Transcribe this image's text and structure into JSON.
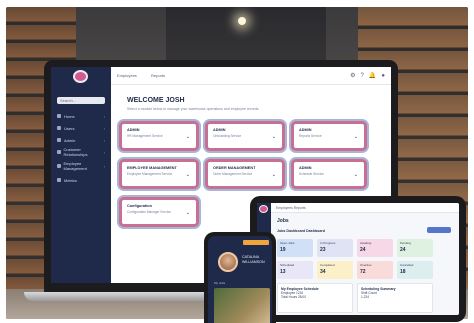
{
  "app": {
    "topbar_menu": [
      "Employees",
      "Reports"
    ],
    "welcome_title": "WELCOME JOSH",
    "welcome_sub": "Select a module below to manage your warehouse operations and employee records."
  },
  "sidebar": {
    "search_placeholder": "Search...",
    "items": [
      {
        "label": "Home"
      },
      {
        "label": "Users"
      },
      {
        "label": "Admin"
      },
      {
        "label": "Customer Relationships"
      },
      {
        "label": "Employee Management"
      },
      {
        "label": "Metrics"
      }
    ]
  },
  "modules": [
    {
      "title": "ADMIN",
      "sub": "HR Management Service"
    },
    {
      "title": "ADMIN",
      "sub": "Onboarding Service"
    },
    {
      "title": "ADMIN",
      "sub": "Reports Service"
    },
    {
      "title": "EMPLOYEE MANAGEMENT",
      "sub": "Employee Management Service"
    },
    {
      "title": "ORDER MANAGEMENT",
      "sub": "Order Management Service"
    },
    {
      "title": "ADMIN",
      "sub": "Schedule Service"
    },
    {
      "title": "Configuration",
      "sub": "Configuration Manager Service"
    }
  ],
  "tablet": {
    "title": "Jobs",
    "section": "Jobs Dashboard Dashboard",
    "top_menu": "Employees   Reports",
    "cards": [
      {
        "label": "Open Jobs",
        "value": "19",
        "color": "#cfe0f7"
      },
      {
        "label": "In Progress",
        "value": "23",
        "color": "#dfe3f3"
      },
      {
        "label": "Awaiting",
        "value": "24",
        "color": "#f7d8e6"
      },
      {
        "label": "Pending",
        "value": "24",
        "color": "#dff2e2"
      },
      {
        "label": "Scheduled",
        "value": "13",
        "color": "#e8e6f7"
      },
      {
        "label": "Completed",
        "value": "34",
        "color": "#fbf0c8"
      },
      {
        "label": "Overdue",
        "value": "72",
        "color": "#f9dcd9"
      },
      {
        "label": "Cancelled",
        "value": "18",
        "color": "#dcefee"
      }
    ],
    "panel_left_title": "My Employee Schedule",
    "panel_left_rows": [
      "Employee 1234",
      "Total Hours 28:00"
    ],
    "panel_right_title": "Scheduling Summary",
    "panel_right_rows": [
      "Shift Count",
      "1,234"
    ]
  },
  "phone": {
    "name": "CATALINA WILLIAMSON",
    "label": "My Jobs"
  },
  "colors": {
    "sidebar": "#1f2a4a",
    "card_border": "#c96f92",
    "accent": "#5476c9"
  }
}
